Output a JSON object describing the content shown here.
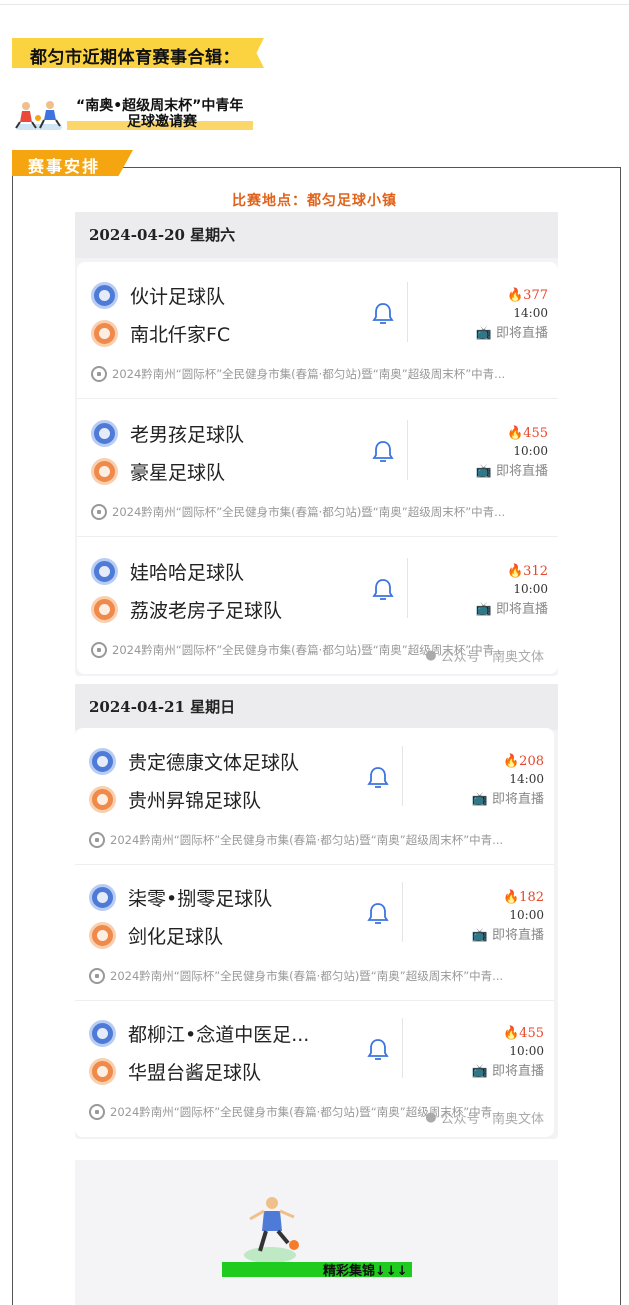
{
  "page": {
    "title": "都匀市近期体育赛事合辑：",
    "subtitle_line1": "“南奥•超级周末杯”中青年",
    "subtitle_line2": "足球邀请赛",
    "section_tab": "赛事安排",
    "venue": "比赛地点：都匀足球小镇"
  },
  "days": [
    {
      "date": "2024-04-20 星期六",
      "matches": [
        {
          "home": "伙计足球队",
          "away": "南北仟家FC",
          "heat": "377",
          "time": "14:00",
          "status": "即将直播",
          "event": "2024黔南州“圆际杯”全民健身市集(春篇·都匀站)暨“南奥”超级周末杯”中青..."
        },
        {
          "home": "老男孩足球队",
          "away": "豪星足球队",
          "heat": "455",
          "time": "10:00",
          "status": "即将直播",
          "event": "2024黔南州“圆际杯”全民健身市集(春篇·都匀站)暨“南奥”超级周末杯”中青..."
        },
        {
          "home": "娃哈哈足球队",
          "away": "荔波老房子足球队",
          "heat": "312",
          "time": "10:00",
          "status": "即将直播",
          "event": "2024黔南州“圆际杯”全民健身市集(春篇·都匀站)暨“南奥”超级周末杯”中青..."
        }
      ],
      "watermark": "公众号 · 南奥文体"
    },
    {
      "date": "2024-04-21 星期日",
      "matches": [
        {
          "home": "贵定德康文体足球队",
          "away": "贵州昇锦足球队",
          "heat": "208",
          "time": "14:00",
          "status": "即将直播",
          "event": "2024黔南州“圆际杯”全民健身市集(春篇·都匀站)暨“南奥”超级周末杯”中青..."
        },
        {
          "home": "柒零•捌零足球队",
          "away": "剑化足球队",
          "heat": "182",
          "time": "10:00",
          "status": "即将直播",
          "event": "2024黔南州“圆际杯”全民健身市集(春篇·都匀站)暨“南奥”超级周末杯”中青..."
        },
        {
          "home": "都柳江•念道中医足...",
          "away": "华盟台酱足球队",
          "heat": "455",
          "time": "10:00",
          "status": "即将直播",
          "event": "2024黔南州“圆际杯”全民健身市集(春篇·都匀站)暨“南奥”超级周末杯”中青..."
        }
      ],
      "watermark": "公众号 · 南奥文体"
    }
  ],
  "highlights": {
    "label": "精彩集锦↓↓↓"
  },
  "colors": {
    "banner": "#fbd341",
    "tab": "#f5a50f",
    "venue": "#e0621a",
    "heat": "#e8462b",
    "bell": "#3d74e0",
    "green": "#1ecb1e"
  },
  "icons": [
    "bell-icon",
    "fire-icon",
    "tv-icon",
    "soccer-ball-icon",
    "wechat-icon",
    "team-badge-icon"
  ]
}
